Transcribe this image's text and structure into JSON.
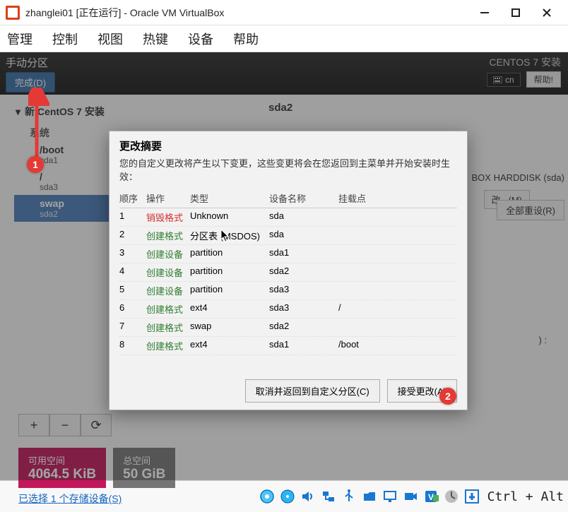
{
  "window": {
    "title": "zhanglei01 [正在运行] - Oracle VM VirtualBox"
  },
  "menu": [
    "管理",
    "控制",
    "视图",
    "热键",
    "设备",
    "帮助"
  ],
  "anaconda": {
    "page_title": "手动分区",
    "done": "完成(D)",
    "installer": "CENTOS 7 安装",
    "keyboard": "cn",
    "help": "帮助!",
    "tree": {
      "heading": "新 CentOS 7 安装",
      "section": "系统",
      "items": [
        {
          "mp": "/boot",
          "dev": "sda1"
        },
        {
          "mp": "/",
          "dev": "sda3"
        },
        {
          "mp": "swap",
          "dev": "sda2",
          "selected": true
        }
      ]
    },
    "right_mount": "sda2",
    "device_label": "BOX HARDDISK (sda)",
    "update_btn": "改...(M)",
    "rparen": ") :",
    "tools": {
      "add": "+",
      "remove": "−",
      "reload": "⟳"
    },
    "space": {
      "avail_lbl": "可用空间",
      "avail_val": "4064.5 KiB",
      "total_lbl": "总空间",
      "total_val": "50 GiB"
    },
    "storage_link": "已选择 1 个存储设备(S)",
    "reset_all": "全部重设(R)"
  },
  "dialog": {
    "title": "更改摘要",
    "message": "您的自定义更改将产生以下变更，这些变更将会在您返回到主菜单并开始安装时生效：",
    "cols": {
      "order": "顺序",
      "action": "操作",
      "type": "类型",
      "device": "设备名称",
      "mount": "挂载点"
    },
    "rows": [
      {
        "n": "1",
        "act": "销毁格式",
        "act_cls": "destroy",
        "type": "Unknown",
        "dev": "sda",
        "mp": ""
      },
      {
        "n": "2",
        "act": "创建格式",
        "act_cls": "create",
        "type": "分区表 (MSDOS)",
        "dev": "sda",
        "mp": ""
      },
      {
        "n": "3",
        "act": "创建设备",
        "act_cls": "create",
        "type": "partition",
        "dev": "sda1",
        "mp": ""
      },
      {
        "n": "4",
        "act": "创建设备",
        "act_cls": "create",
        "type": "partition",
        "dev": "sda2",
        "mp": ""
      },
      {
        "n": "5",
        "act": "创建设备",
        "act_cls": "create",
        "type": "partition",
        "dev": "sda3",
        "mp": ""
      },
      {
        "n": "6",
        "act": "创建格式",
        "act_cls": "create",
        "type": "ext4",
        "dev": "sda3",
        "mp": "/"
      },
      {
        "n": "7",
        "act": "创建格式",
        "act_cls": "create",
        "type": "swap",
        "dev": "sda2",
        "mp": ""
      },
      {
        "n": "8",
        "act": "创建格式",
        "act_cls": "create",
        "type": "ext4",
        "dev": "sda1",
        "mp": "/boot"
      }
    ],
    "cancel": "取消并返回到自定义分区(C)",
    "accept": "接受更改(A)"
  },
  "badges": {
    "one": "1",
    "two": "2"
  },
  "statusbar": {
    "hostkey": "Ctrl + Alt"
  }
}
